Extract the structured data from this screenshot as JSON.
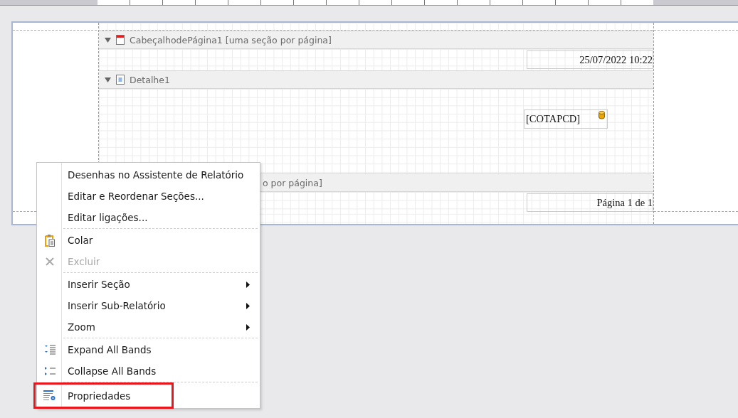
{
  "bands": [
    {
      "kind": "header",
      "label": "CabeçalhodePágina1 [uma seção por página]",
      "expanded": true,
      "field": "25/07/2022 10:22"
    },
    {
      "kind": "detail",
      "label": "Detalhe1",
      "expanded": true,
      "field": "[COTAPCD]"
    },
    {
      "kind": "footer",
      "label": "o por página]",
      "field": "Página 1 de 1"
    }
  ],
  "context_menu": {
    "items": [
      {
        "kind": "item",
        "label": "Desenhas no Assistente de Relatório",
        "disabled": false,
        "submenu": false,
        "highlighted": false
      },
      {
        "kind": "item",
        "label": "Editar e Reordenar Seções...",
        "disabled": false,
        "submenu": false,
        "highlighted": false
      },
      {
        "kind": "item",
        "label": "Editar ligações...",
        "disabled": false,
        "submenu": false,
        "highlighted": false
      },
      {
        "kind": "separator"
      },
      {
        "kind": "paste",
        "label": "Colar",
        "disabled": false,
        "submenu": false,
        "highlighted": false
      },
      {
        "kind": "delete",
        "label": "Excluir",
        "disabled": true,
        "submenu": false,
        "highlighted": false
      },
      {
        "kind": "separator"
      },
      {
        "kind": "item",
        "label": "Inserir Seção",
        "disabled": false,
        "submenu": true,
        "highlighted": false
      },
      {
        "kind": "item",
        "label": "Inserir Sub-Relatório",
        "disabled": false,
        "submenu": true,
        "highlighted": false
      },
      {
        "kind": "item",
        "label": "Zoom",
        "disabled": false,
        "submenu": true,
        "highlighted": false
      },
      {
        "kind": "separator"
      },
      {
        "kind": "expand",
        "label": "Expand All Bands",
        "disabled": false,
        "submenu": false,
        "highlighted": false
      },
      {
        "kind": "collapse",
        "label": "Collapse All Bands",
        "disabled": false,
        "submenu": false,
        "highlighted": false
      },
      {
        "kind": "separator"
      },
      {
        "kind": "properties",
        "label": "Propriedades",
        "disabled": false,
        "submenu": false,
        "highlighted": true
      }
    ]
  }
}
